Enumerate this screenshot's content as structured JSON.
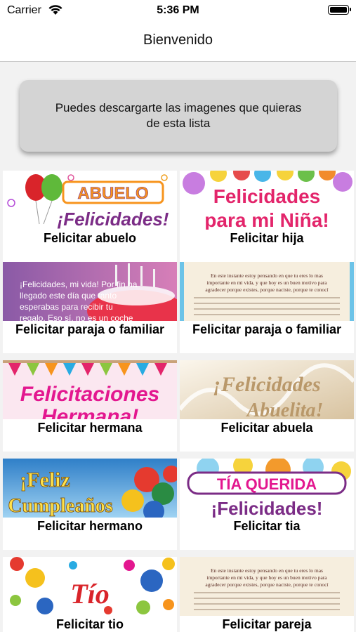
{
  "status": {
    "carrier": "Carrier",
    "time": "5:36 PM"
  },
  "nav": {
    "title": "Bienvenido"
  },
  "info": {
    "text": "Puedes descargarte las imagenes que quieras de esta lista"
  },
  "items": [
    {
      "caption": "Felicitar abuelo",
      "image_text": [
        "ABUELO",
        "¡Felicidades!"
      ]
    },
    {
      "caption": "Felicitar hija",
      "image_text": [
        "Felicidades",
        "para mi Niña!"
      ]
    },
    {
      "caption": "Felicitar paraja o familiar",
      "image_text": [
        "¡Felicidades, mi vida! Por fin ha",
        "llegado este día que tanto",
        "esperabas para recibir tu",
        "regalo. Eso sí, no es un coche"
      ]
    },
    {
      "caption": "Felicitar paraja o familiar",
      "image_text": [
        "En este instante estoy pensando en que tu eres lo mas",
        "importante en mi vida, y que hoy es un buen motivo para",
        "agradecer porque existes, porque naciste, porque te conocí"
      ]
    },
    {
      "caption": "Felicitar hermana",
      "image_text": [
        "Felicitaciones",
        "Hermana!"
      ]
    },
    {
      "caption": "Felicitar abuela",
      "image_text": [
        "¡Felicidades",
        "Abuelita!"
      ]
    },
    {
      "caption": "Felicitar hermano",
      "image_text": [
        "¡Feliz",
        "Cumpleaños"
      ]
    },
    {
      "caption": "Felicitar tia",
      "image_text": [
        "TÍA QUERIDA",
        "¡Felicidades!"
      ]
    },
    {
      "caption": "Felicitar tio",
      "image_text": [
        "Tío"
      ]
    },
    {
      "caption": "Felicitar pareja",
      "image_text": [
        "En este instante estoy pensando en que tu eres lo mas",
        "importante en mi vida, y que hoy es un buen motivo para",
        "agradecer porque existes, porque naciste, porque te conocí"
      ]
    }
  ]
}
